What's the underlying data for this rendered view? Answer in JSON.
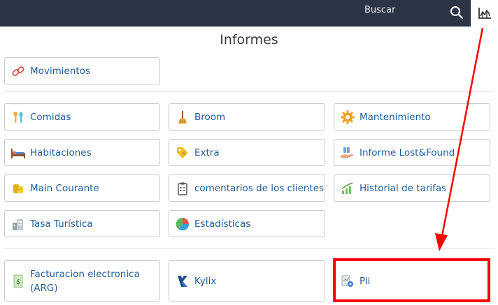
{
  "header": {
    "search_label": "Buscar",
    "search_icon": "magnifier-icon",
    "reports_icon": "bar-chart-icon"
  },
  "page": {
    "title": "Informes"
  },
  "reports": {
    "movimientos": "Movimientos",
    "comidas": "Comidas",
    "broom": "Broom",
    "mantenimiento": "Mantenimiento",
    "habitaciones": "Habitaciones",
    "extra": "Extra",
    "lost_found": "Informe Lost&Found",
    "main_courante": "Main Courante",
    "comentarios": "comentarios de los clientes",
    "historial_tarifas": "Historial de tarifas",
    "tasa_turistica": "Tasa Turística",
    "estadisticas": "Estadísticas",
    "facturacion": "Facturacion electronica (ARG)",
    "kylix": "Kylix",
    "pii": "Pii"
  },
  "colors": {
    "topbar": "#2b3445",
    "link": "#1f5d99",
    "annotation": "#ff0000"
  }
}
